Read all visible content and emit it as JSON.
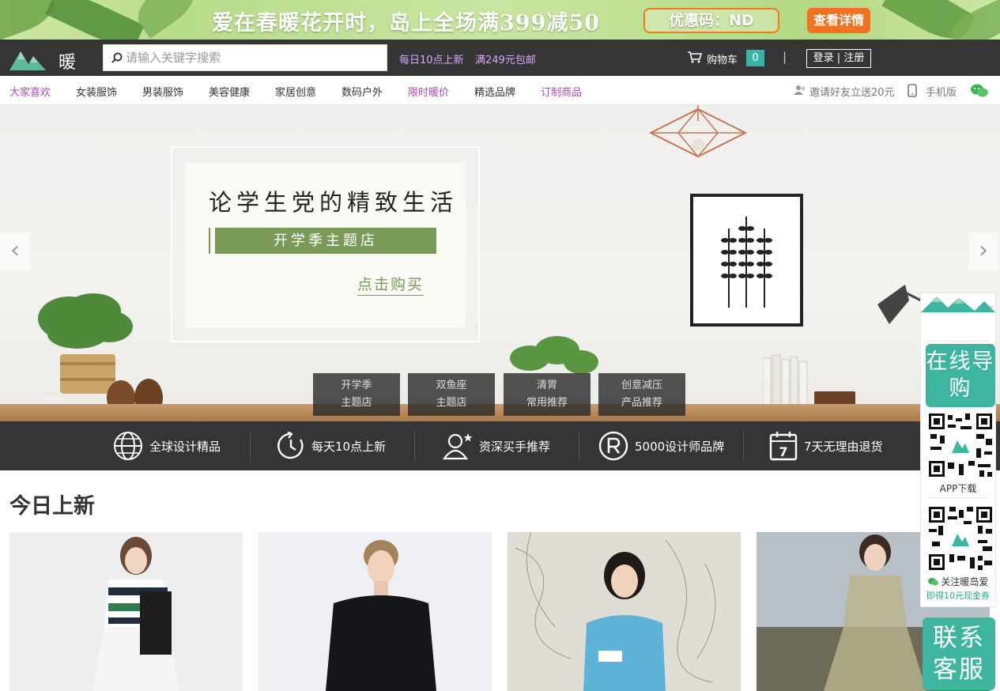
{
  "promo": {
    "text": "爱在春暖花开时，岛上全场满399减50",
    "coupon": "优惠码：ND",
    "button": "查看详情"
  },
  "header": {
    "logo_text": "暖岛",
    "search_placeholder": "请输入关键字搜索",
    "tag1": "每日10点上新",
    "tag2": "满249元包邮",
    "cart_label": "购物车",
    "cart_count": "0",
    "separator": "|",
    "login": "登录 | 注册"
  },
  "nav": {
    "items": [
      "大家喜欢",
      "女装服饰",
      "男装服饰",
      "美容健康",
      "家居创意",
      "数码户外",
      "限时暖价",
      "精选品牌",
      "订制商品"
    ],
    "invite": "邀请好友立送20元",
    "mobile": "手机版"
  },
  "hero": {
    "title": "论学生党的精致生活",
    "subtitle": "开学季主题店",
    "link": "点击购买",
    "prev": "‹",
    "next": "›",
    "tabs": [
      {
        "line1": "开学季",
        "line2": "主题店"
      },
      {
        "line1": "双鱼座",
        "line2": "主题店"
      },
      {
        "line1": "清胃",
        "line2": "常用推荐"
      },
      {
        "line1": "创意减压",
        "line2": "产品推荐"
      }
    ]
  },
  "features": [
    "全球设计精品",
    "每天10点上新",
    "资深买手推荐",
    "5000设计师品牌",
    "7天无理由退货"
  ],
  "section": {
    "title": "今日上新"
  },
  "float": {
    "close": "x",
    "guide": "在线导购",
    "app_label": "APP下载",
    "follow_label": "关注暖岛爱",
    "follow_promo": "即得10元现金券",
    "service": "联系客服"
  },
  "colors": {
    "accent": "#3eb59e",
    "nav_highlight": "#b04ab8",
    "header_bg": "#353535",
    "promo_orange": "#f4721f"
  }
}
